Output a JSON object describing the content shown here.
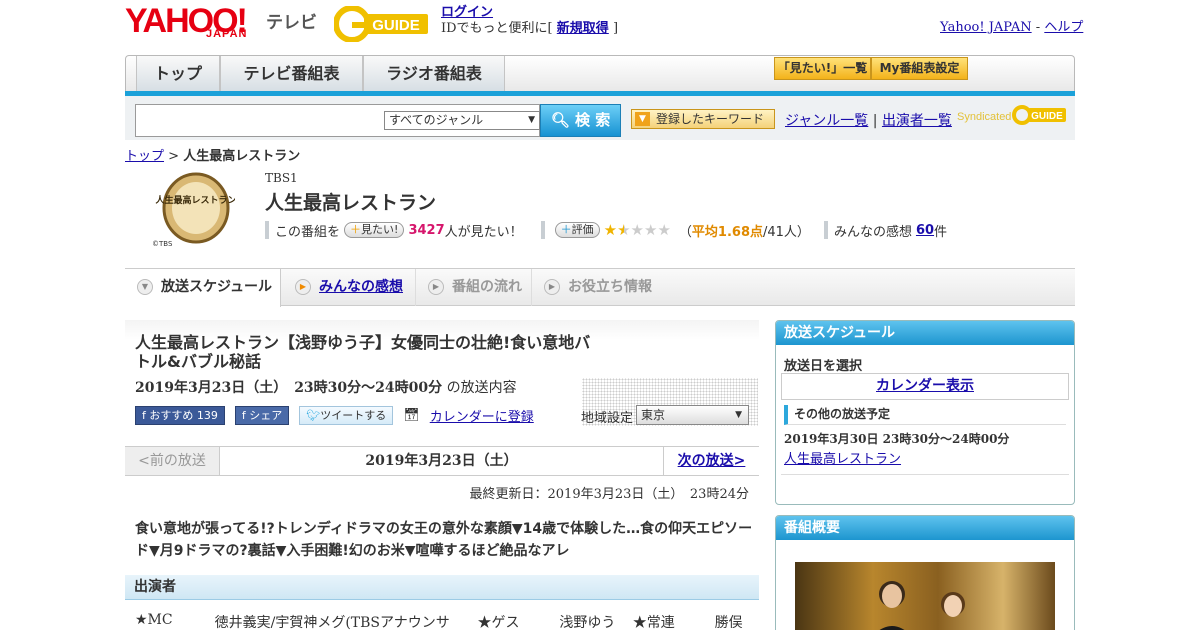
{
  "header": {
    "logo_yahoo": "YAHOO!",
    "logo_japan": "JAPAN",
    "logo_tv": "テレビ",
    "logo_gguide": "GUIDE",
    "login_label": "ログイン",
    "login_text_pre": "IDでもっと便利に[",
    "signup_label": "新規取得",
    "login_text_post": "]",
    "yahoo_japan_link": "Yahoo! JAPAN",
    "link_separator": "-",
    "help_link": "ヘルプ"
  },
  "nav": {
    "tabs": [
      {
        "label": "トップ"
      },
      {
        "label": "テレビ番組表"
      },
      {
        "label": "ラジオ番組表"
      }
    ],
    "mitai_list": "「見たい!」一覧",
    "my_schedule": "My番組表設定"
  },
  "search": {
    "query": "",
    "genre_selected": "すべてのジャンル",
    "button_label": "検 索",
    "keyword_button": "登録したキーワード",
    "genre_list_link": "ジャンル一覧",
    "link_separator": "|",
    "cast_list_link": "出演者一覧",
    "syndicated": "Syndicated"
  },
  "breadcrumb": {
    "top": "トップ",
    "separator": ">",
    "current": "人生最高レストラン"
  },
  "program": {
    "logo_text": "人生最高レストラン",
    "logo_copyright": "©TBS",
    "channel": "TBS1",
    "title": "人生最高レストラン",
    "this_program": "この番組を",
    "mitai_button": "見たい!",
    "mitai_count": "3427",
    "mitai_suffix": "人が見たい！",
    "rating_button": "評価",
    "rating_stars": 1.68,
    "rating_avg_prefix": "（",
    "rating_avg": "平均1.68点",
    "rating_votes": "/41人）",
    "impressions_label": "みんなの感想",
    "impressions_count": "60",
    "impressions_suffix": "件"
  },
  "tabs": [
    {
      "label": "放送スケジュール",
      "state": "active"
    },
    {
      "label": "みんなの感想",
      "state": "link"
    },
    {
      "label": "番組の流れ",
      "state": "disabled"
    },
    {
      "label": "お役立ち情報",
      "state": "disabled"
    }
  ],
  "episode": {
    "title": "人生最高レストラン【浅野ゆう子】女優同士の壮絶!食い意地バトル&バブル秘話",
    "datetime": "2019年3月23日（土）　23時30分～24時00分",
    "datetime_suffix": "の放送内容",
    "fb_recommend": "おすすめ",
    "fb_count": "139",
    "fb_share": "シェア",
    "tweet": "ツイートする",
    "calendar_register": "カレンダーに登録",
    "region_label": "地域設定",
    "region_value": "東京",
    "prev_label": "<前の放送",
    "current_date": "2019年3月23日（土）",
    "next_label": "次の放送>",
    "last_updated": "最終更新日：2019年3月23日（土）　23時24分",
    "summary": "食い意地が張ってる!?トレンディドラマの女王の意外な素顔▼14歳で体験した…食の仰天エピソード▼月9ドラマの?裏話▼入手困難!幻のお米▼喧嘩するほど絶品なアレ",
    "cast_heading": "出演者",
    "cast": [
      "★MC",
      "徳井義実/宇賀神メグ(TBSアナウンサー)",
      "★ゲスト",
      "浅野ゆう子",
      "★常連客",
      "勝俣州"
    ]
  },
  "sidebar": {
    "schedule_heading": "放送スケジュール",
    "select_date": "放送日を選択",
    "calendar_link": "カレンダー表示",
    "other_schedule": "その他の放送予定",
    "other_date": "2019年3月30日  23時30分～24時00分",
    "other_title": "人生最高レストラン",
    "overview_heading": "番組概要"
  }
}
